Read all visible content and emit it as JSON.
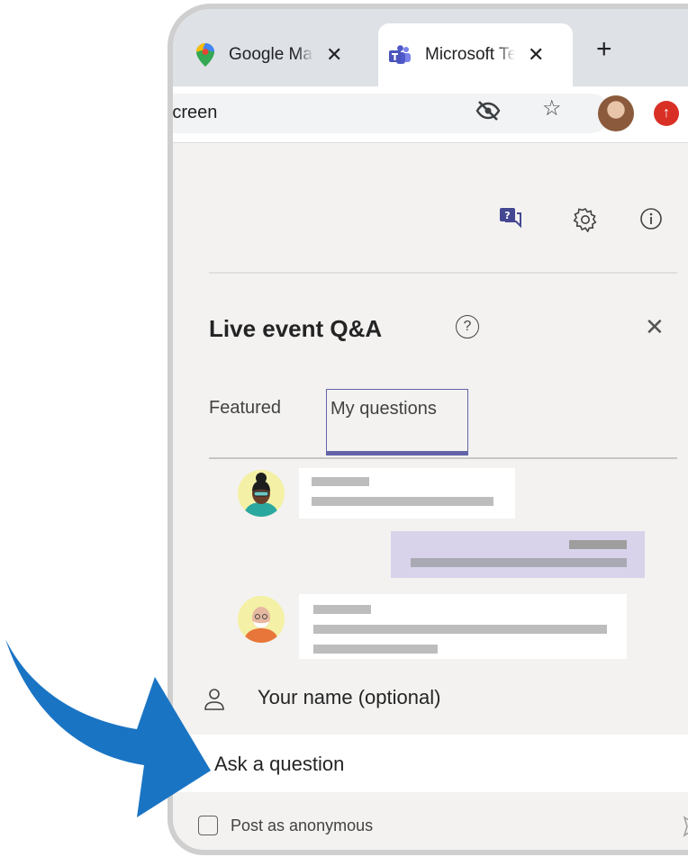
{
  "browser": {
    "tabs": [
      {
        "label": "Google Maps",
        "icon": "maps-pin-icon"
      },
      {
        "label": "Microsoft Teams",
        "icon": "teams-icon",
        "active": true
      }
    ],
    "url_text": "kScreen"
  },
  "panel": {
    "title": "Live event Q&A",
    "tabs": [
      {
        "label": "Featured"
      },
      {
        "label": "My questions",
        "selected": true
      }
    ],
    "name_label": "Your name (optional)",
    "question_placeholder": "Ask a question",
    "anonymous_label": "Post as anonymous"
  },
  "colors": {
    "accent": "#6264a7",
    "arrow": "#1a74c4",
    "own_bubble": "#d8d3ea"
  }
}
